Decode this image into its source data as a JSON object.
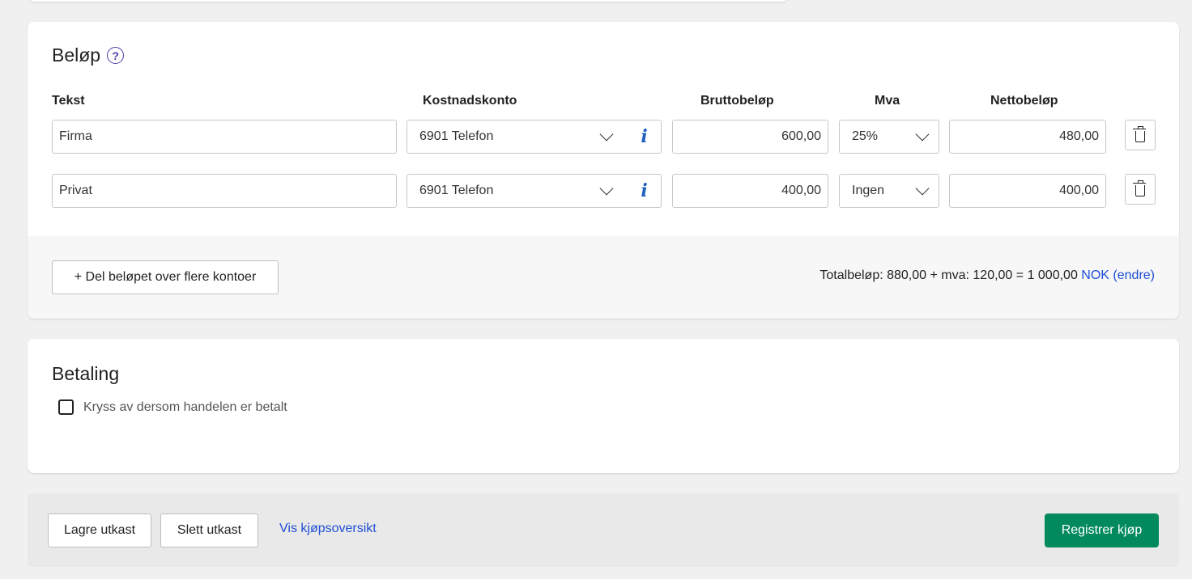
{
  "belop": {
    "title": "Beløp",
    "help_icon": "question-circle-icon",
    "columns": {
      "tekst": "Tekst",
      "kostnadskonto": "Kostnadskonto",
      "brutto": "Bruttobeløp",
      "mva": "Mva",
      "netto": "Nettobeløp"
    },
    "rows": [
      {
        "tekst": "Firma",
        "konto": "6901 Telefon",
        "brutto": "600,00",
        "mva": "25%",
        "netto": "480,00"
      },
      {
        "tekst": "Privat",
        "konto": "6901 Telefon",
        "brutto": "400,00",
        "mva": "Ingen",
        "netto": "400,00"
      }
    ],
    "info_glyph": "i",
    "split_button": "+ Del beløpet over flere kontoer",
    "total_text": "Totalbeløp: 880,00 + mva: 120,00 = 1 000,00",
    "currency_link": "NOK (endre)"
  },
  "betaling": {
    "title": "Betaling",
    "checkbox_label": "Kryss av dersom handelen er betalt",
    "checked": false
  },
  "actions": {
    "save_draft": "Lagre utkast",
    "delete_draft": "Slett utkast",
    "view_overview": "Vis kjøpsoversikt",
    "register": "Registrer kjøp"
  },
  "colors": {
    "primary": "#028a5e",
    "link": "#1f4fd6",
    "help": "#4b3fa6"
  }
}
